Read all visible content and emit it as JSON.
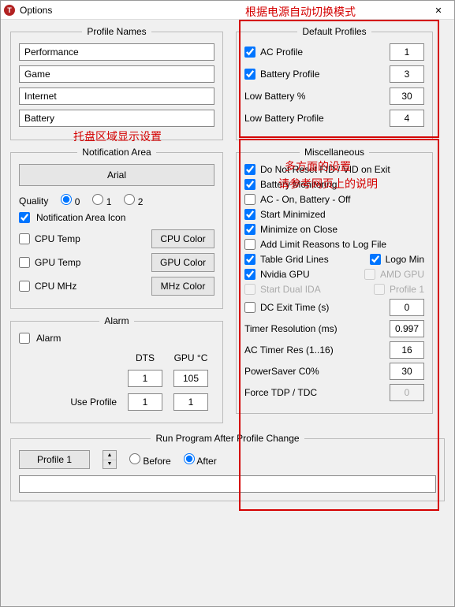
{
  "window": {
    "title": "Options",
    "icon_letter": "T"
  },
  "annotations": {
    "top": "根据电源自动切换模式",
    "tray": "托盘区域显示设置",
    "misc1": "多方面的设置",
    "misc2": "请参考网页上的说明"
  },
  "profileNames": {
    "legend": "Profile Names",
    "items": [
      "Performance",
      "Game",
      "Internet",
      "Battery"
    ]
  },
  "defaultProfiles": {
    "legend": "Default Profiles",
    "ac_label": "AC Profile",
    "ac_checked": true,
    "ac_value": "1",
    "batt_label": "Battery Profile",
    "batt_checked": true,
    "batt_value": "3",
    "lowbatt_pct_label": "Low Battery %",
    "lowbatt_pct_value": "30",
    "lowbatt_prof_label": "Low Battery Profile",
    "lowbatt_prof_value": "4"
  },
  "notification": {
    "legend": "Notification Area",
    "font_btn": "Arial",
    "quality_label": "Quality",
    "q_options": [
      "0",
      "1",
      "2"
    ],
    "q_selected": 0,
    "icon_label": "Notification Area Icon",
    "icon_checked": true,
    "cpu_temp_label": "CPU Temp",
    "cpu_temp_checked": false,
    "cpu_color_btn": "CPU Color",
    "gpu_temp_label": "GPU Temp",
    "gpu_temp_checked": false,
    "gpu_color_btn": "GPU Color",
    "cpu_mhz_label": "CPU MHz",
    "cpu_mhz_checked": false,
    "mhz_color_btn": "MHz Color"
  },
  "alarm": {
    "legend": "Alarm",
    "alarm_label": "Alarm",
    "alarm_checked": false,
    "dts_header": "DTS",
    "gpuc_header": "GPU °C",
    "dts_value": "1",
    "gpuc_value": "105",
    "use_profile_label": "Use Profile",
    "prof_dts": "1",
    "prof_gpu": "1"
  },
  "misc": {
    "legend": "Miscellaneous",
    "no_reset_label": "Do Not Reset FID / VID on Exit",
    "no_reset_checked": true,
    "batt_mon_label": "Battery Monitoring",
    "batt_mon_checked": true,
    "ac_on_label": "AC - On, Battery - Off",
    "ac_on_checked": false,
    "start_min_label": "Start Minimized",
    "start_min_checked": true,
    "min_close_label": "Minimize on Close",
    "min_close_checked": true,
    "add_limit_label": "Add Limit Reasons to Log File",
    "add_limit_checked": false,
    "grid_label": "Table Grid Lines",
    "grid_checked": true,
    "logo_label": "Logo Min",
    "logo_checked": true,
    "nvidia_label": "Nvidia GPU",
    "nvidia_checked": true,
    "amd_label": "AMD GPU",
    "amd_checked": false,
    "dual_ida_label": "Start Dual IDA",
    "dual_ida_checked": false,
    "profile1_label": "Profile 1",
    "profile1_checked": false,
    "dc_exit_label": "DC Exit Time (s)",
    "dc_exit_checked": false,
    "dc_exit_value": "0",
    "timer_res_label": "Timer Resolution (ms)",
    "timer_res_value": "0.997",
    "ac_timer_label": "AC Timer Res (1..16)",
    "ac_timer_value": "16",
    "psaver_label": "PowerSaver C0%",
    "psaver_value": "30",
    "force_tdp_label": "Force TDP / TDC",
    "force_tdp_value": "0"
  },
  "run": {
    "legend": "Run Program After Profile Change",
    "profile_btn": "Profile 1",
    "before_label": "Before",
    "after_label": "After",
    "selected": "after",
    "path": ""
  }
}
